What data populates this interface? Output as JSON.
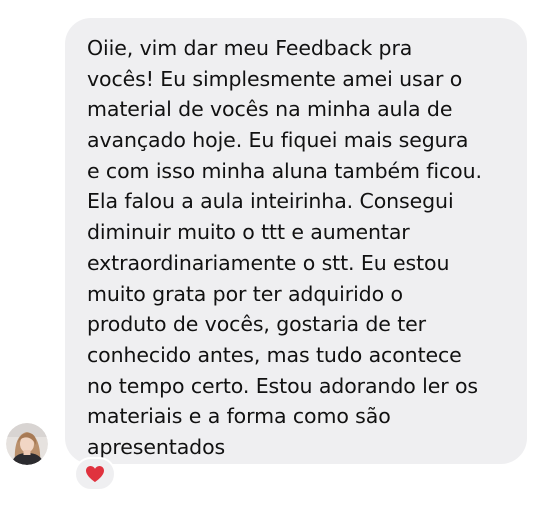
{
  "message": {
    "lines": [
      "Oiie, vim dar meu Feedback pra",
      "vocês! Eu simplesmente amei usar o",
      "material de vocês na minha aula de",
      "avançado hoje. Eu fiquei mais segura",
      "e com isso minha aluna também ficou.",
      "Ela falou a aula inteirinha. Consegui",
      "diminuir muito o ttt e aumentar",
      "extraordinariamente o stt. Eu estou",
      "muito grata por ter adquirido o",
      "produto de vocês, gostaria de ter",
      "conhecido antes, mas tudo acontece",
      "no tempo certo. Estou adorando ler os",
      "materiais e a forma como são",
      "apresentados"
    ],
    "bubble_color": "#efeff1"
  },
  "reaction": {
    "icon": "heart-icon",
    "color": "#e0323e"
  },
  "avatar": {
    "icon": "profile-photo"
  }
}
